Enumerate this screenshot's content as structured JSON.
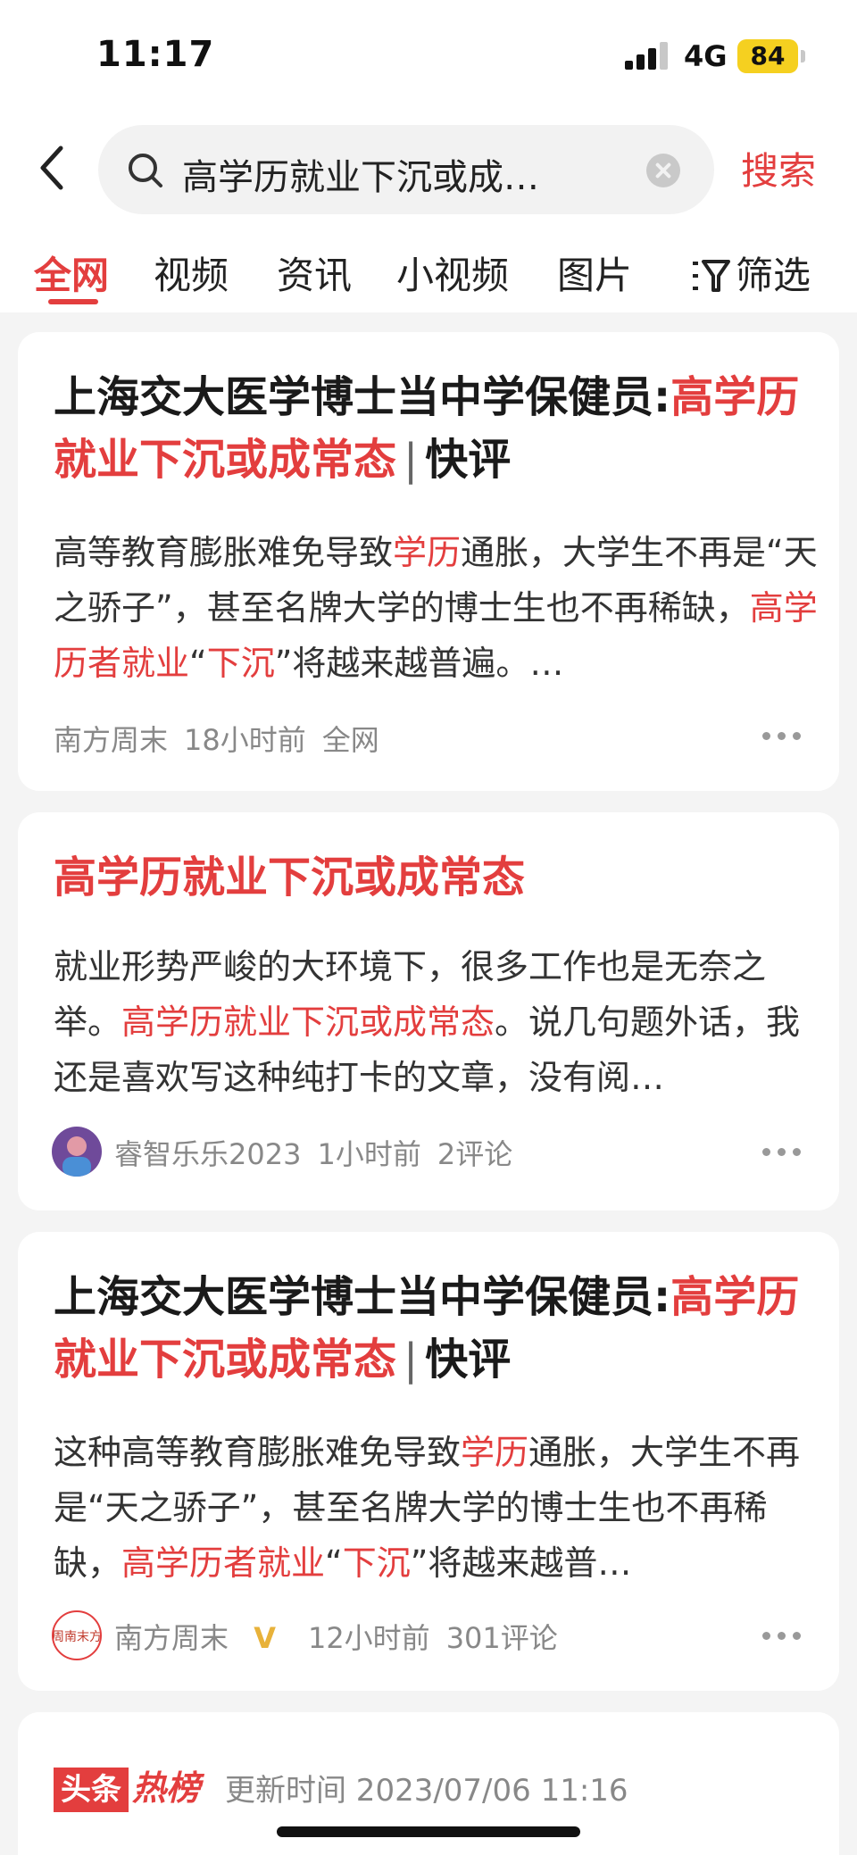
{
  "status_bar": {
    "time": "11:17",
    "network": "4G",
    "battery": "84"
  },
  "search": {
    "query": "高学历就业下沉或成…",
    "button_label": "搜索"
  },
  "tabs": [
    {
      "label": "全网",
      "active": true
    },
    {
      "label": "视频"
    },
    {
      "label": "资讯"
    },
    {
      "label": "小视频"
    },
    {
      "label": "图片"
    }
  ],
  "filter_label": "筛选",
  "results": [
    {
      "title_normal": "上海交大医学博士当中学保健员:",
      "title_highlight": "高学历就业下沉或成常态",
      "title_sep": "|",
      "title_suffix": "快评",
      "summary": [
        {
          "t": "高等教育膨胀难免导致"
        },
        {
          "t": "学历",
          "hl": true
        },
        {
          "t": "通胀，大学生不再是“天之骄子”，甚至名牌大学的博士生也不再稀缺，"
        },
        {
          "t": "高学历者就业",
          "hl": true
        },
        {
          "t": "“"
        },
        {
          "t": "下沉",
          "hl": true
        },
        {
          "t": "”将越来越普遍。…"
        }
      ],
      "meta": {
        "source": "南方周末",
        "time": "18小时前",
        "scope": "全网"
      }
    },
    {
      "title": "高学历就业下沉或成常态",
      "summary": [
        {
          "t": "就业形势严峻的大环境下，很多工作也是无奈之举。"
        },
        {
          "t": "高学历就业下沉或成常态",
          "hl": true
        },
        {
          "t": "。说几句题外话，我还是喜欢写这种纯打卡的文章，没有阅…"
        }
      ],
      "meta": {
        "author": "睿智乐乐2023",
        "time": "1小时前",
        "comments": "2评论"
      }
    },
    {
      "title_normal": "上海交大医学博士当中学保健员:",
      "title_highlight": "高学历就业下沉或成常态",
      "title_sep": "|",
      "title_suffix": "快评",
      "summary": [
        {
          "t": "这种高等教育膨胀难免导致"
        },
        {
          "t": "学历",
          "hl": true
        },
        {
          "t": "通胀，大学生不再是“天之骄子”，甚至名牌大学的博士生也不再稀缺，"
        },
        {
          "t": "高学历者就业",
          "hl": true
        },
        {
          "t": "“"
        },
        {
          "t": "下沉",
          "hl": true
        },
        {
          "t": "”将越来越普…"
        }
      ],
      "meta": {
        "author": "南方周末",
        "verified": "V",
        "time": "12小时前",
        "comments": "301评论",
        "avatar_text": "周南末方"
      }
    }
  ],
  "hotlist": {
    "logo_box": "头条",
    "logo_word": "热榜",
    "update_time": "更新时间 2023/07/06 11:16"
  },
  "colors": {
    "accent": "#e33e3e",
    "background": "#f4f4f4",
    "battery": "#f5d020"
  }
}
